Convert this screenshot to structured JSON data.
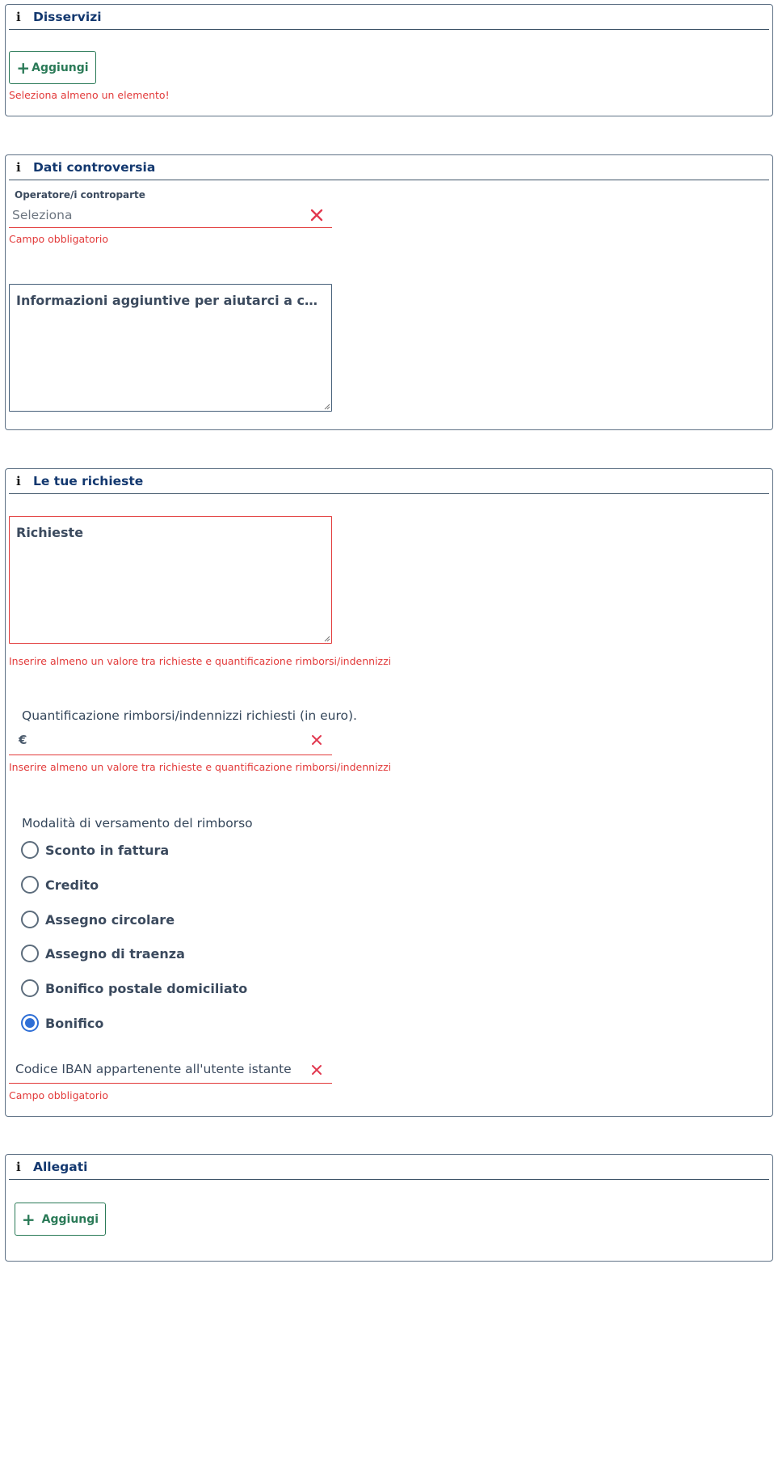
{
  "disservizi": {
    "title": "Disservizi",
    "add_label": "Aggiungi",
    "error": "Seleziona almeno un elemento!"
  },
  "dati_controversia": {
    "title": "Dati controversia",
    "operatori_label": "Operatore/i controparte",
    "operatori_placeholder": "Seleziona",
    "operatori_error": "Campo obbligatorio",
    "info_placeholder": "Informazioni aggiuntive per aiutarci a comprendere meglio la controversia"
  },
  "richieste": {
    "title": "Le tue richieste",
    "richieste_placeholder": "Richieste",
    "richieste_error": "Inserire almeno un valore tra richieste e quantificazione rimborsi/indennizzi",
    "quantificazione_label": "Quantificazione rimborsi/indennizzi richiesti (in euro).",
    "currency_symbol": "€",
    "quantificazione_error": "Inserire almeno un valore tra richieste e quantificazione rimborsi/indennizzi",
    "modalita_label": "Modalità di versamento del rimborso",
    "options": [
      {
        "label": "Sconto in fattura",
        "checked": false
      },
      {
        "label": "Credito",
        "checked": false
      },
      {
        "label": "Assegno circolare",
        "checked": false
      },
      {
        "label": "Assegno di traenza",
        "checked": false
      },
      {
        "label": "Bonifico postale domiciliato",
        "checked": false
      },
      {
        "label": "Bonifico",
        "checked": true
      }
    ],
    "iban_placeholder": "Codice IBAN appartenente all'utente istante",
    "iban_error": "Campo obbligatorio"
  },
  "allegati": {
    "title": "Allegati",
    "add_label": "Aggiungi"
  },
  "colors": {
    "title": "#13386f",
    "button_green": "#2a7a57",
    "error_red": "#e23a3a",
    "radio_selected": "#2f6fd6"
  },
  "icons": [
    "info-icon",
    "plus-icon",
    "close-icon",
    "resize-grip-icon"
  ]
}
